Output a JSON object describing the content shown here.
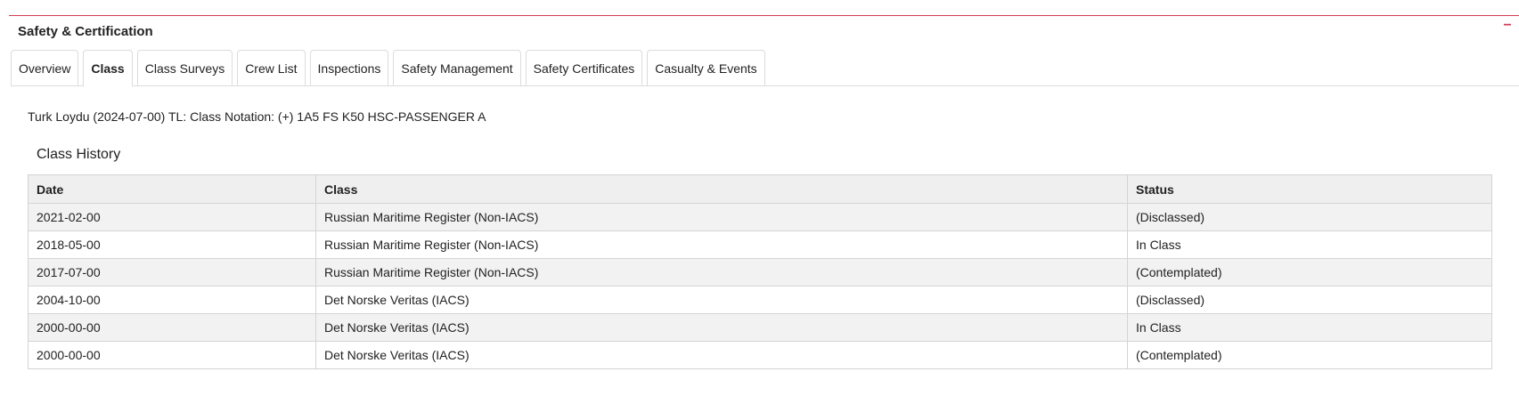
{
  "panel": {
    "title": "Safety & Certification",
    "collapse_label": "−"
  },
  "tabs": [
    {
      "label": "Overview"
    },
    {
      "label": "Class"
    },
    {
      "label": "Class Surveys"
    },
    {
      "label": "Crew List"
    },
    {
      "label": "Inspections"
    },
    {
      "label": "Safety Management"
    },
    {
      "label": "Safety Certificates"
    },
    {
      "label": "Casualty & Events"
    }
  ],
  "active_tab": "Class",
  "class_notation": "Turk Loydu (2024-07-00) TL: Class Notation: (+) 1A5 FS K50 HSC-PASSENGER A",
  "class_history": {
    "title": "Class History",
    "columns": [
      "Date",
      "Class",
      "Status"
    ],
    "rows": [
      {
        "date": "2021-02-00",
        "class": "Russian Maritime Register (Non-IACS)",
        "status": "(Disclassed)"
      },
      {
        "date": "2018-05-00",
        "class": "Russian Maritime Register (Non-IACS)",
        "status": "In Class"
      },
      {
        "date": "2017-07-00",
        "class": "Russian Maritime Register (Non-IACS)",
        "status": "(Contemplated)"
      },
      {
        "date": "2004-10-00",
        "class": "Det Norske Veritas (IACS)",
        "status": "(Disclassed)"
      },
      {
        "date": "2000-00-00",
        "class": "Det Norske Veritas (IACS)",
        "status": "In Class"
      },
      {
        "date": "2000-00-00",
        "class": "Det Norske Veritas (IACS)",
        "status": "(Contemplated)"
      }
    ]
  },
  "colors": {
    "accent": "#d43a55",
    "header_bg": "#efefef",
    "stripe_bg": "#f2f2f2"
  }
}
